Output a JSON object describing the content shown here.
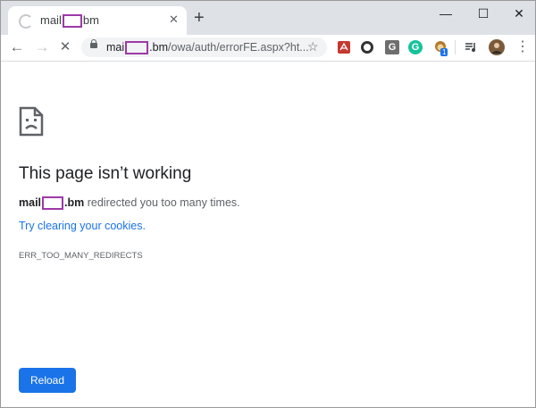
{
  "tab": {
    "title_prefix": "mail",
    "title_suffix": "bm",
    "close": "✕"
  },
  "newtab": "+",
  "window": {
    "minimize": "—",
    "maximize": "☐",
    "close": "✕"
  },
  "nav": {
    "back": "←",
    "forward": "→",
    "stop": "✕"
  },
  "url": {
    "host_prefix": "mai",
    "host_suffix": ".bm",
    "path": "/owa/auth/errorFE.aspx?ht..."
  },
  "star": "☆",
  "extensions": [
    {
      "icon": "pdf-icon",
      "badge": ""
    },
    {
      "icon": "circle-extension-icon",
      "badge": ""
    },
    {
      "icon": "g-extension-icon",
      "letter": "G"
    },
    {
      "icon": "grammarly-icon",
      "letter": "G"
    },
    {
      "icon": "monkey-extension-icon",
      "badge": "1"
    }
  ],
  "menu": "⋮",
  "error": {
    "heading": "This page isn’t working",
    "host_prefix": "mail",
    "host_suffix": ".bm",
    "message": "redirected you too many times.",
    "link": "Try clearing your cookies.",
    "code": "ERR_TOO_MANY_REDIRECTS",
    "reload": "Reload"
  },
  "colors": {
    "accent": "#1a73e8",
    "redaction": "#9c3aa7"
  }
}
